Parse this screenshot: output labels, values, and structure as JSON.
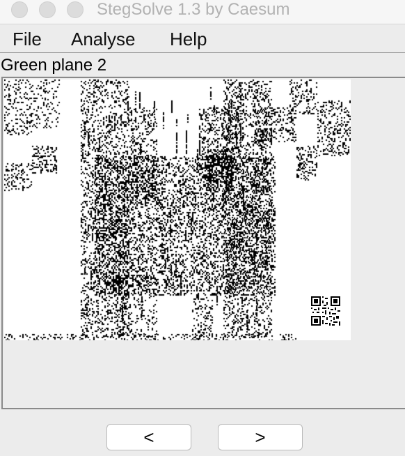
{
  "window": {
    "title": "StegSolve 1.3 by Caesum"
  },
  "menu": {
    "items": [
      {
        "label": "File"
      },
      {
        "label": "Analyse"
      },
      {
        "label": "Help"
      }
    ]
  },
  "viewer": {
    "plane_label": "Green plane 2",
    "image_content": "noisy bit plane render with QR code in lower right"
  },
  "nav": {
    "prev_label": "<",
    "next_label": ">"
  },
  "colors": {
    "background": "#ececec",
    "image_background": "#ffffff",
    "pixel": "#000000"
  }
}
